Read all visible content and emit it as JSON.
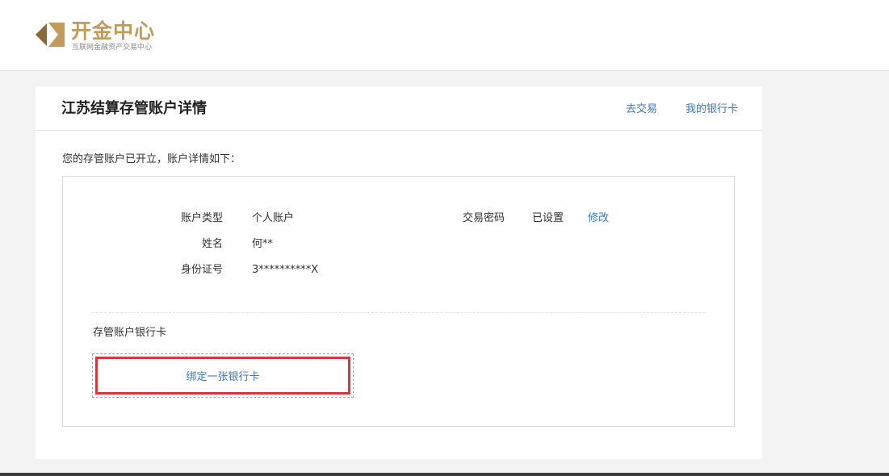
{
  "brand": {
    "name": "开金中心",
    "tagline": "互联网金融资产交易中心",
    "colors": {
      "gold": "#c39a5a",
      "gold_dark": "#8a6a3a"
    }
  },
  "header": {
    "title": "江苏结算存管账户详情",
    "links": {
      "trade": "去交易",
      "my_cards": "我的银行卡"
    }
  },
  "intro": "您的存管账户已开立，账户详情如下：",
  "details": {
    "account_type": {
      "label": "账户类型",
      "value": "个人账户"
    },
    "name": {
      "label": "姓名",
      "value": "何**"
    },
    "id_number": {
      "label": "身份证号",
      "value": "3**********X"
    },
    "trade_password": {
      "label": "交易密码",
      "value": "已设置",
      "action": "修改"
    }
  },
  "bank_card": {
    "title": "存管账户银行卡",
    "bind_label": "绑定一张银行卡"
  },
  "colors": {
    "link": "#3a78c2",
    "highlight": "#d9363e"
  }
}
